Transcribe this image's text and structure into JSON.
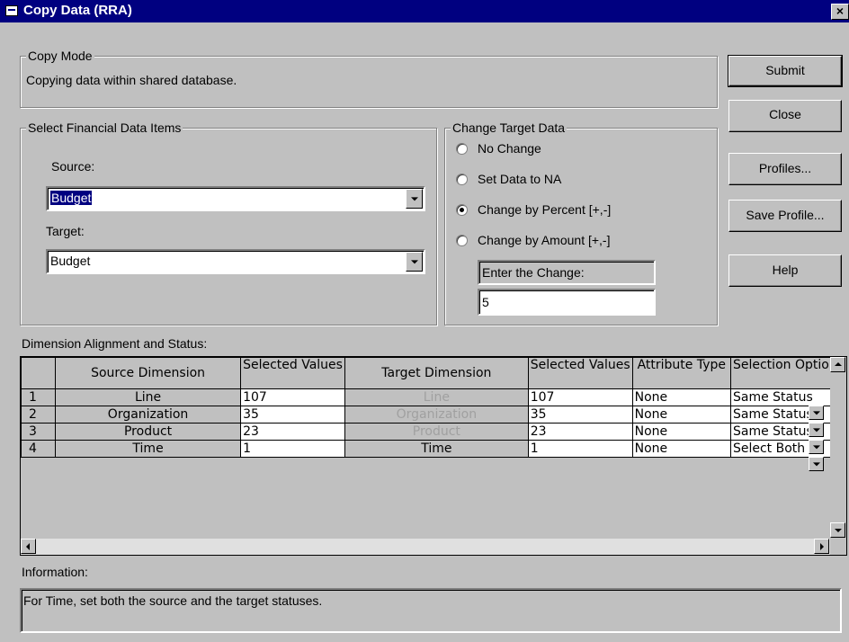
{
  "window": {
    "title": "Copy Data (RRA)",
    "close_glyph": "×"
  },
  "copy_mode": {
    "legend": "Copy Mode",
    "text": "Copying data within shared database."
  },
  "buttons": {
    "submit": "Submit",
    "close": "Close",
    "profiles": "Profiles...",
    "save_profile": "Save Profile...",
    "help": "Help"
  },
  "financial": {
    "legend": "Select Financial Data Items",
    "source_label": "Source:",
    "source_value": "Budget",
    "target_label": "Target:",
    "target_value": "Budget"
  },
  "change_target": {
    "legend": "Change Target Data",
    "options": [
      "No Change",
      "Set Data to NA",
      "Change by Percent [+,-]",
      "Change by Amount [+,-]"
    ],
    "selected_index": 2,
    "enter_label": "Enter the Change:",
    "enter_value": "5"
  },
  "dimension": {
    "label": "Dimension Alignment and Status:",
    "headers": [
      "Source Dimension",
      "Selected Values",
      "Target Dimension",
      "Selected Values",
      "Attribute Type",
      "Selection Options"
    ],
    "rows": [
      {
        "num": "1",
        "source": "Line",
        "src_values": "107",
        "target": "Line",
        "tgt_values": "107",
        "attr": "None",
        "option": "Same Status"
      },
      {
        "num": "2",
        "source": "Organization",
        "src_values": "35",
        "target": "Organization",
        "tgt_values": "35",
        "attr": "None",
        "option": "Same Status"
      },
      {
        "num": "3",
        "source": "Product",
        "src_values": "23",
        "target": "Product",
        "tgt_values": "23",
        "attr": "None",
        "option": "Same Status"
      },
      {
        "num": "4",
        "source": "Time",
        "src_values": "1",
        "target": "Time",
        "tgt_values": "1",
        "attr": "None",
        "option": "Select Both"
      }
    ]
  },
  "information": {
    "label": "Information:",
    "text": "For Time, set both the source and the target statuses."
  },
  "icons": [
    "window-icon",
    "close-icon",
    "dropdown-arrow-icon",
    "scroll-up-icon",
    "scroll-down-icon",
    "scroll-left-icon",
    "scroll-right-icon"
  ]
}
